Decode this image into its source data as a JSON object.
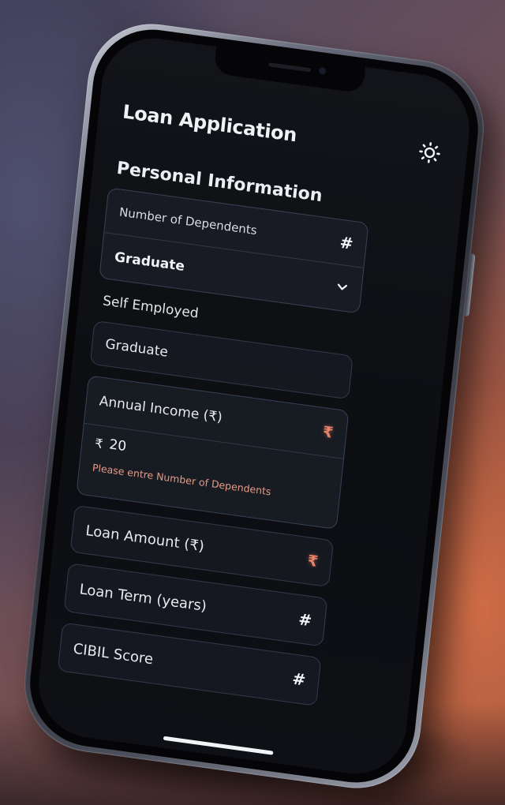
{
  "app": {
    "title": "Loan Application",
    "theme_icon": "sun-icon"
  },
  "personal_info": {
    "section_title": "Personal Information",
    "dependents": {
      "placeholder": "Number of Dependents",
      "icon": "hash-icon",
      "icon_glyph": "#"
    },
    "education_select": {
      "value": "Graduate",
      "icon": "chevron-down-icon"
    }
  },
  "self_employed": {
    "label": "Self Employed",
    "value": "Graduate"
  },
  "annual_income": {
    "label": "Annual Income (₹)",
    "icon_glyph": "₹",
    "currency_symbol": "₹",
    "value": "20",
    "error": "Please entre Number of Dependents"
  },
  "loan_amount": {
    "label": "Loan Amount (₹)",
    "icon_glyph": "₹"
  },
  "loan_term": {
    "label": "Loan Term (years)",
    "icon_glyph": "#"
  },
  "cibil_score": {
    "label": "CIBIL Score",
    "icon_glyph": "#"
  },
  "colors": {
    "accent": "#e8836a",
    "background": "#0c0e12",
    "border": "#3a4156",
    "text": "#e8eaf0"
  }
}
